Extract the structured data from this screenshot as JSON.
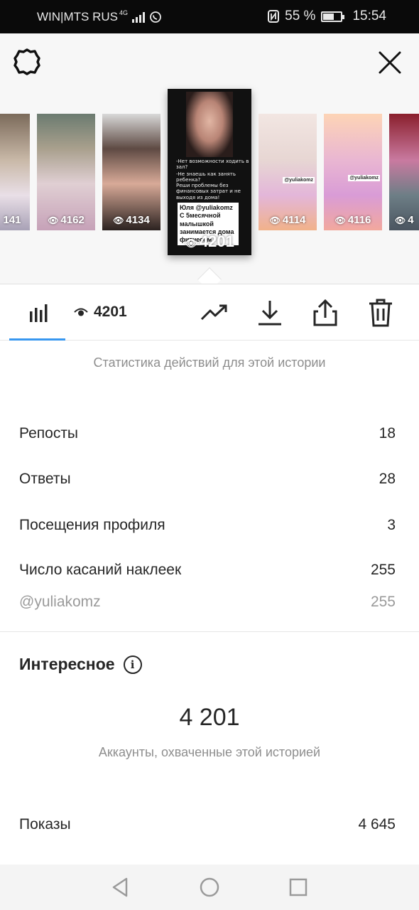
{
  "status_bar": {
    "carrier": "WIN|MTS RUS",
    "network": "4G",
    "battery_text": "55 %",
    "battery_level": 0.55,
    "time": "15:54"
  },
  "stories": [
    {
      "views": "141"
    },
    {
      "views": "4162"
    },
    {
      "views": "4134"
    },
    {
      "views": "4201",
      "selected": true,
      "text_lines": [
        "-Нет возможности ходить в зал?",
        "-Не знаешь как занять ребенка?",
        "Реши проблемы без финансовых затрат и не выходя из дома!"
      ],
      "sticker_text": "Юля @yuliakomz С 5месячной малышкой занимается дома фитнесом !"
    },
    {
      "views": "4114",
      "tag": "@yuliakomz"
    },
    {
      "views": "4116",
      "tag": "@yuliakomz"
    },
    {
      "views": "4"
    }
  ],
  "toolbar": {
    "views": "4201"
  },
  "caption": "Статистика действий для этой истории",
  "stats": [
    {
      "label": "Репосты",
      "value": "18"
    },
    {
      "label": "Ответы",
      "value": "28"
    },
    {
      "label": "Посещения профиля",
      "value": "3"
    },
    {
      "label": "Число касаний наклеек",
      "value": "255"
    }
  ],
  "sticker_row": {
    "label": "@yuliakomz",
    "value": "255"
  },
  "discovery": {
    "title": "Интересное",
    "reach": "4 201",
    "reach_caption": "Аккаунты, охваченные этой историей",
    "impressions_label": "Показы",
    "impressions_value": "4 645"
  },
  "colors": {
    "accent": "#3897f0",
    "text": "#262626",
    "muted": "#8e8e8e"
  }
}
